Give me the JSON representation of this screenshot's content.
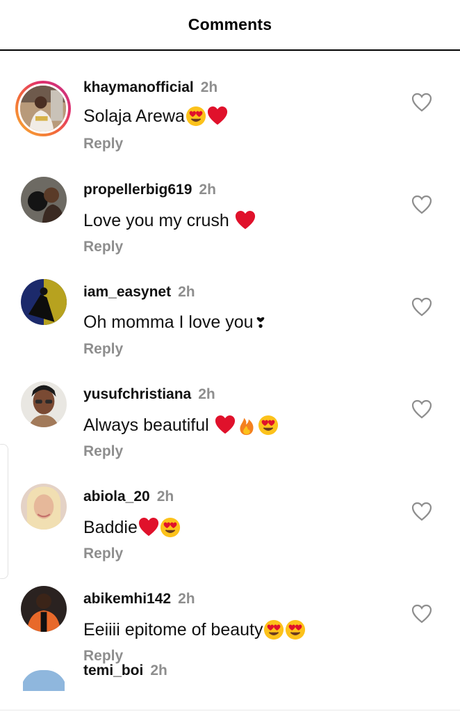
{
  "header": {
    "title": "Comments"
  },
  "reply_label": "Reply",
  "comments": [
    {
      "username": "khaymanofficial",
      "time": "2h",
      "text": "Solaja Arewa",
      "emojis": [
        "heart-eyes",
        "red-heart"
      ]
    },
    {
      "username": "propellerbig619",
      "time": "2h",
      "text": "Love you my crush ",
      "emojis": [
        "red-heart"
      ]
    },
    {
      "username": "iam_easynet",
      "time": "2h",
      "text": "Oh momma I love you ",
      "emojis": [
        "heart-exclamation"
      ]
    },
    {
      "username": "yusufchristiana",
      "time": "2h",
      "text": "Always beautiful ",
      "emojis": [
        "red-heart",
        "fire",
        "heart-eyes"
      ]
    },
    {
      "username": "abiola_20",
      "time": "2h",
      "text": "Baddie",
      "emojis": [
        "red-heart",
        "heart-eyes"
      ]
    },
    {
      "username": "abikemhi142",
      "time": "2h",
      "text": "Eeiiii epitome of beauty",
      "emojis": [
        "heart-eyes",
        "heart-eyes"
      ]
    },
    {
      "username": "temi_boi",
      "time": "2h"
    }
  ],
  "colors": {
    "muted": "#8e8e8e",
    "heart": "#e0112b",
    "emoji_face": "#fcc21b"
  }
}
